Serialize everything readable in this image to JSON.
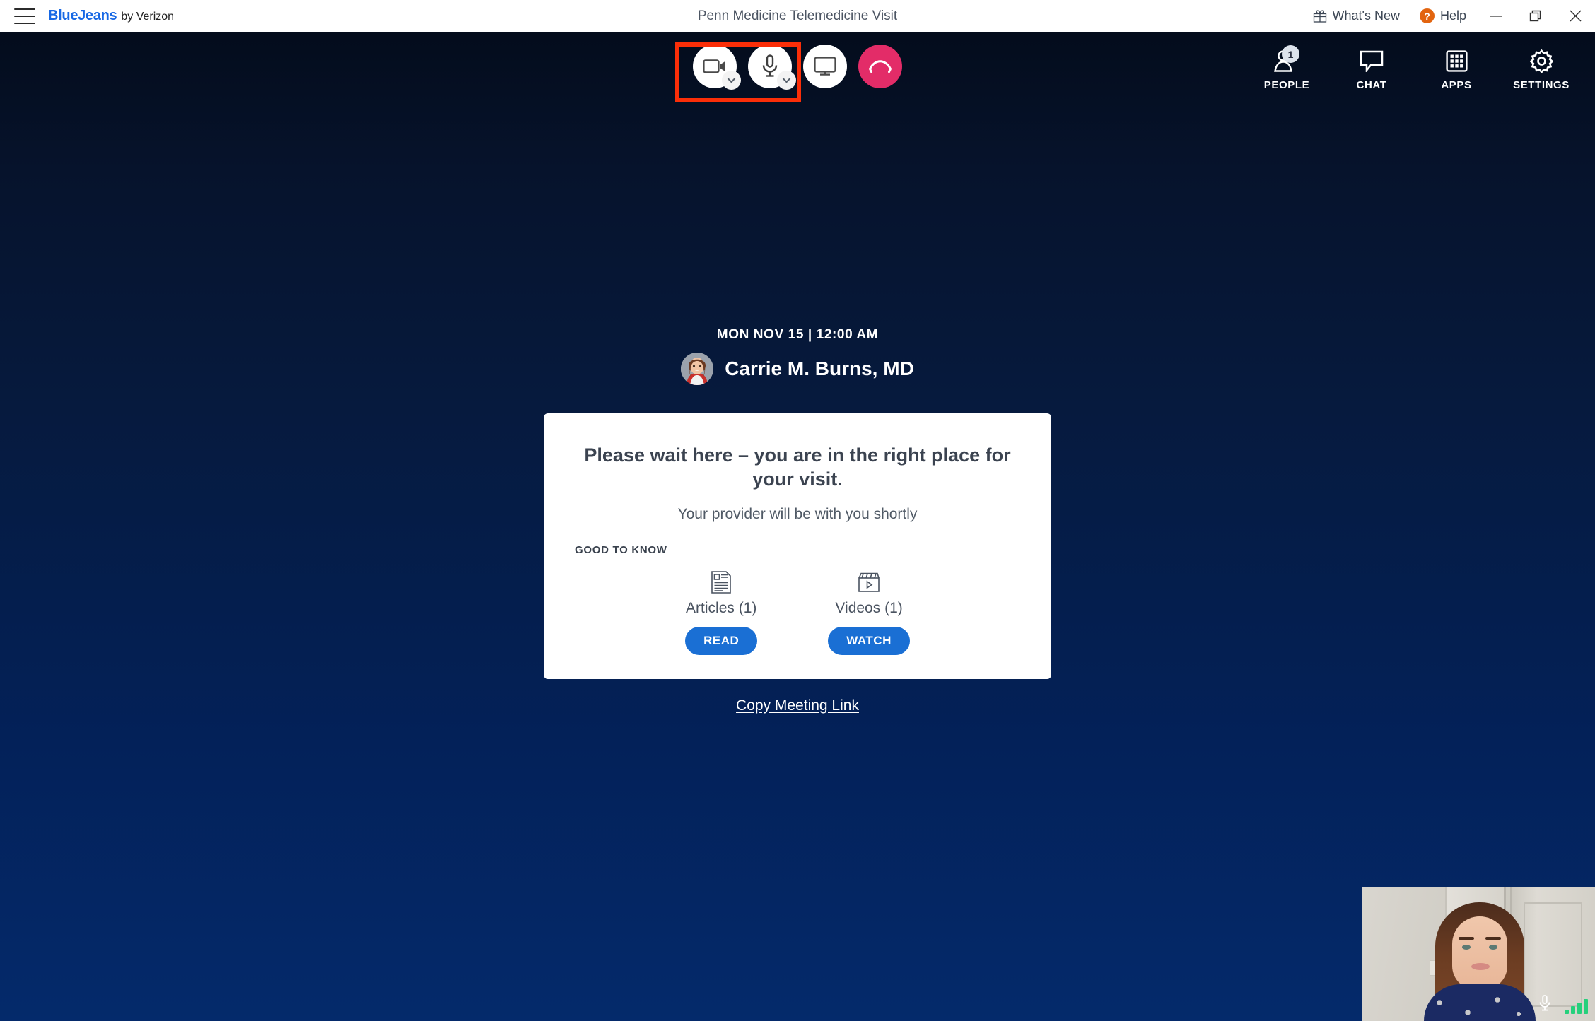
{
  "titlebar": {
    "menu_icon": "hamburger-icon",
    "brand_name": "BlueJeans",
    "brand_suffix": "by Verizon",
    "window_title": "Penn Medicine Telemedicine Visit",
    "whats_new_label": "What's New",
    "help_label": "Help",
    "help_glyph": "?",
    "minimize_glyph": "—",
    "restore_glyph": "❐",
    "close_glyph": "✕"
  },
  "controls": {
    "camera": {
      "name": "camera-button",
      "icon": "video-camera-icon",
      "has_dropdown": true
    },
    "microphone": {
      "name": "microphone-button",
      "icon": "microphone-icon",
      "has_dropdown": true
    },
    "screenshare": {
      "name": "screen-share-button",
      "icon": "monitor-icon"
    },
    "hangup": {
      "name": "hangup-button",
      "icon": "phone-hangup-icon",
      "color": "#e32c68"
    },
    "highlight_color": "#fb2e08"
  },
  "right_tools": [
    {
      "label": "PEOPLE",
      "icon": "people-icon",
      "badge": "1"
    },
    {
      "label": "CHAT",
      "icon": "chat-bubble-icon"
    },
    {
      "label": "APPS",
      "icon": "apps-grid-icon"
    },
    {
      "label": "SETTINGS",
      "icon": "gear-icon"
    }
  ],
  "meeting": {
    "date_time": "MON NOV 15 | 12:00 AM",
    "host_name": "Carrie M. Burns, MD"
  },
  "card": {
    "title": "Please wait here – you are in the right place for your visit.",
    "subtitle": "Your provider will be with you shortly",
    "section_label": "GOOD TO KNOW",
    "tiles": [
      {
        "icon": "article-icon",
        "label": "Articles (1)",
        "button": "READ"
      },
      {
        "icon": "video-clapper-icon",
        "label": "Videos (1)",
        "button": "WATCH"
      }
    ],
    "button_color": "#1a6fd4"
  },
  "copy_link_label": "Copy Meeting Link",
  "selfview": {
    "mic_icon": "microphone-icon",
    "signal_icon": "signal-bars-icon",
    "signal_color": "#26d07c"
  }
}
